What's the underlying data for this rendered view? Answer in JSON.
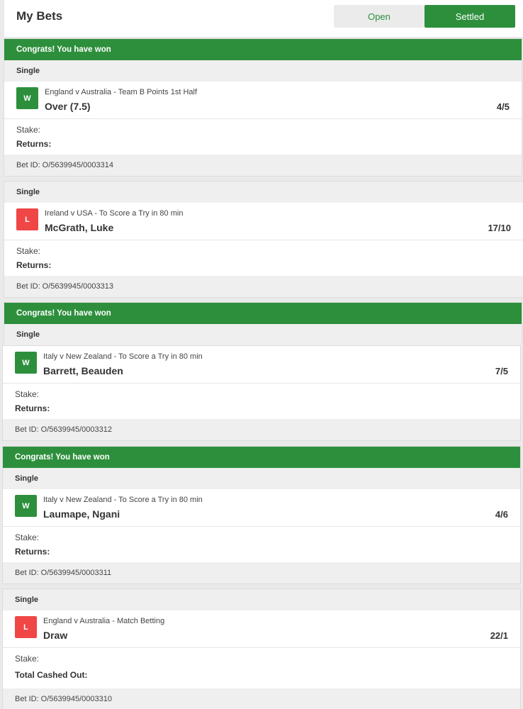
{
  "header": {
    "title": "My Bets",
    "tab_open": "Open",
    "tab_settled": "Settled"
  },
  "labels": {
    "congrats": "Congrats! You have won",
    "single": "Single",
    "stake": "Stake:",
    "returns": "Returns:",
    "total_cashed_out": "Total Cashed Out:"
  },
  "bets": [
    {
      "result": "W",
      "market": "England v Australia - Team B Points 1st Half",
      "selection": "Over (7.5)",
      "odds": "4/5",
      "bet_id": "Bet ID: O/5639945/0003314"
    },
    {
      "result": "L",
      "market": "Ireland v USA - To Score a Try in 80 min",
      "selection": "McGrath, Luke",
      "odds": "17/10",
      "bet_id": "Bet ID: O/5639945/0003313"
    },
    {
      "result": "W",
      "market": "Italy v New Zealand - To Score a Try in 80 min",
      "selection": "Barrett, Beauden",
      "odds": "7/5",
      "bet_id": "Bet ID: O/5639945/0003312"
    },
    {
      "result": "W",
      "market": "Italy v New Zealand - To Score a Try in 80 min",
      "selection": "Laumape, Ngani",
      "odds": "4/6",
      "bet_id": "Bet ID: O/5639945/0003311"
    },
    {
      "result": "L",
      "market": "England v Australia - Match Betting",
      "selection": "Draw",
      "odds": "22/1",
      "bet_id": "Bet ID: O/5639945/0003310"
    }
  ],
  "colors": {
    "green": "#2d8f3c",
    "red": "#f04646"
  }
}
